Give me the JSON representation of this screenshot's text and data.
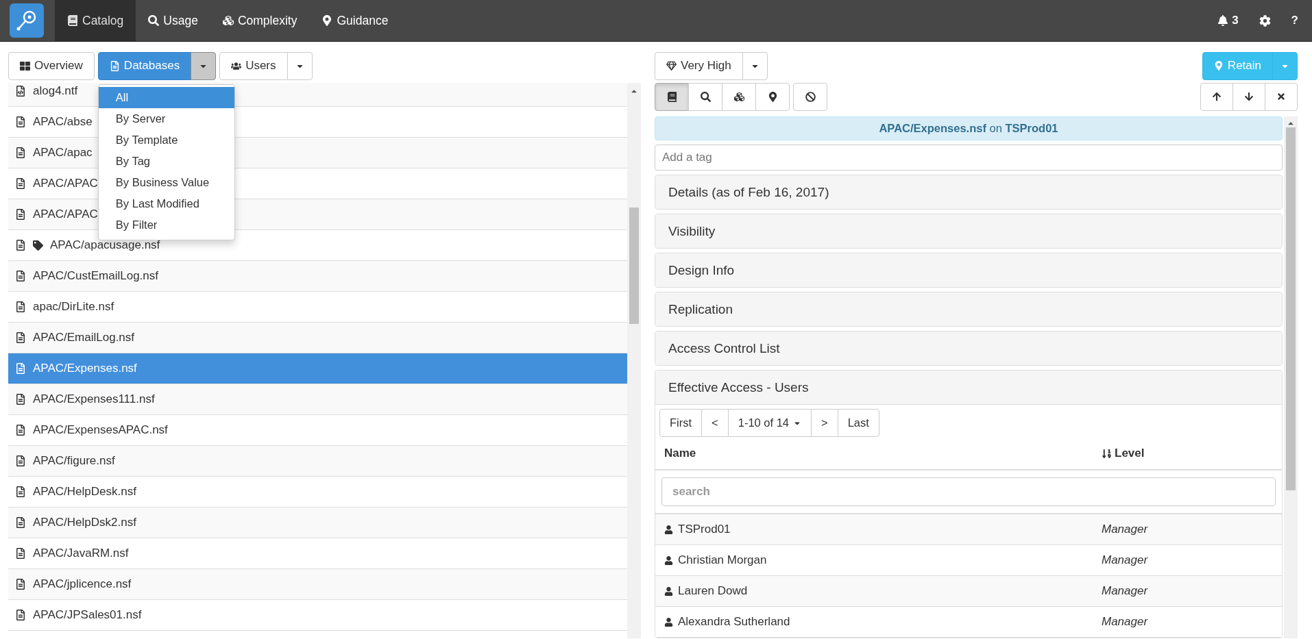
{
  "nav": {
    "items": [
      {
        "label": "Catalog",
        "selected": true
      },
      {
        "label": "Usage",
        "selected": false
      },
      {
        "label": "Complexity",
        "selected": false
      },
      {
        "label": "Guidance",
        "selected": false
      }
    ],
    "notifications": "3",
    "help": "?"
  },
  "left_toolbar": [
    {
      "label": "Overview",
      "selected": false
    },
    {
      "label": "Databases",
      "selected": true,
      "expanded": true
    },
    {
      "label": "Users",
      "selected": false,
      "expanded": false
    }
  ],
  "dropdown_menu": [
    {
      "label": "All",
      "selected": true
    },
    {
      "label": "By Server",
      "selected": false
    },
    {
      "label": "By Template",
      "selected": false
    },
    {
      "label": "By Tag",
      "selected": false
    },
    {
      "label": "By Business Value",
      "selected": false
    },
    {
      "label": "By Last Modified",
      "selected": false
    },
    {
      "label": "By Filter",
      "selected": false
    }
  ],
  "databases": [
    {
      "name": "alog4.ntf",
      "kind": "template",
      "tagged": false,
      "selected": false
    },
    {
      "name": "APAC/abse",
      "kind": "database",
      "tagged": false,
      "selected": false
    },
    {
      "name": "APAC/apac",
      "kind": "database",
      "tagged": false,
      "selected": false
    },
    {
      "name": "APAC/APAC",
      "kind": "database",
      "tagged": false,
      "selected": false
    },
    {
      "name": "APAC/APAC",
      "kind": "database",
      "tagged": false,
      "selected": false
    },
    {
      "name": "APAC/apacusage.nsf",
      "kind": "database",
      "tagged": true,
      "selected": false
    },
    {
      "name": "APAC/CustEmailLog.nsf",
      "kind": "database",
      "tagged": false,
      "selected": false
    },
    {
      "name": "apac/DirLite.nsf",
      "kind": "database",
      "tagged": false,
      "selected": false
    },
    {
      "name": "APAC/EmailLog.nsf",
      "kind": "database",
      "tagged": false,
      "selected": false
    },
    {
      "name": "APAC/Expenses.nsf",
      "kind": "database",
      "tagged": false,
      "selected": true
    },
    {
      "name": "APAC/Expenses111.nsf",
      "kind": "database",
      "tagged": false,
      "selected": false
    },
    {
      "name": "APAC/ExpensesAPAC.nsf",
      "kind": "database",
      "tagged": false,
      "selected": false
    },
    {
      "name": "APAC/figure.nsf",
      "kind": "database",
      "tagged": false,
      "selected": false
    },
    {
      "name": "APAC/HelpDesk.nsf",
      "kind": "database",
      "tagged": false,
      "selected": false
    },
    {
      "name": "APAC/HelpDsk2.nsf",
      "kind": "database",
      "tagged": false,
      "selected": false
    },
    {
      "name": "APAC/JavaRM.nsf",
      "kind": "database",
      "tagged": false,
      "selected": false
    },
    {
      "name": "APAC/jplicence.nsf",
      "kind": "database",
      "tagged": false,
      "selected": false
    },
    {
      "name": "APAC/JPSales01.nsf",
      "kind": "database",
      "tagged": false,
      "selected": false
    }
  ],
  "business_value": {
    "label": "Very High"
  },
  "retain_button": {
    "label": "Retain"
  },
  "view_tabs": [
    {
      "selected": true
    },
    {
      "selected": false
    },
    {
      "selected": false
    },
    {
      "selected": false
    }
  ],
  "banner": {
    "database": "APAC/Expenses.nsf",
    "connector": "on",
    "server": "TSProd01"
  },
  "tag_input": {
    "placeholder": "Add a tag"
  },
  "sections": [
    {
      "title": "Details (as of Feb 16, 2017)",
      "expanded": false
    },
    {
      "title": "Visibility",
      "expanded": false
    },
    {
      "title": "Design Info",
      "expanded": false
    },
    {
      "title": "Replication",
      "expanded": false
    },
    {
      "title": "Access Control List",
      "expanded": false
    },
    {
      "title": "Effective Access - Users",
      "expanded": true
    }
  ],
  "access_table": {
    "pagination": [
      "First",
      "<",
      "1-10 of 14",
      ">",
      "Last"
    ],
    "columns": [
      "Name",
      "Level"
    ],
    "search": {
      "placeholder": "search"
    },
    "rows": [
      {
        "name": "TSProd01",
        "level": "Manager"
      },
      {
        "name": "Christian Morgan",
        "level": "Manager"
      },
      {
        "name": "Lauren Dowd",
        "level": "Manager"
      },
      {
        "name": "Alexandra Sutherland",
        "level": "Manager"
      }
    ]
  }
}
